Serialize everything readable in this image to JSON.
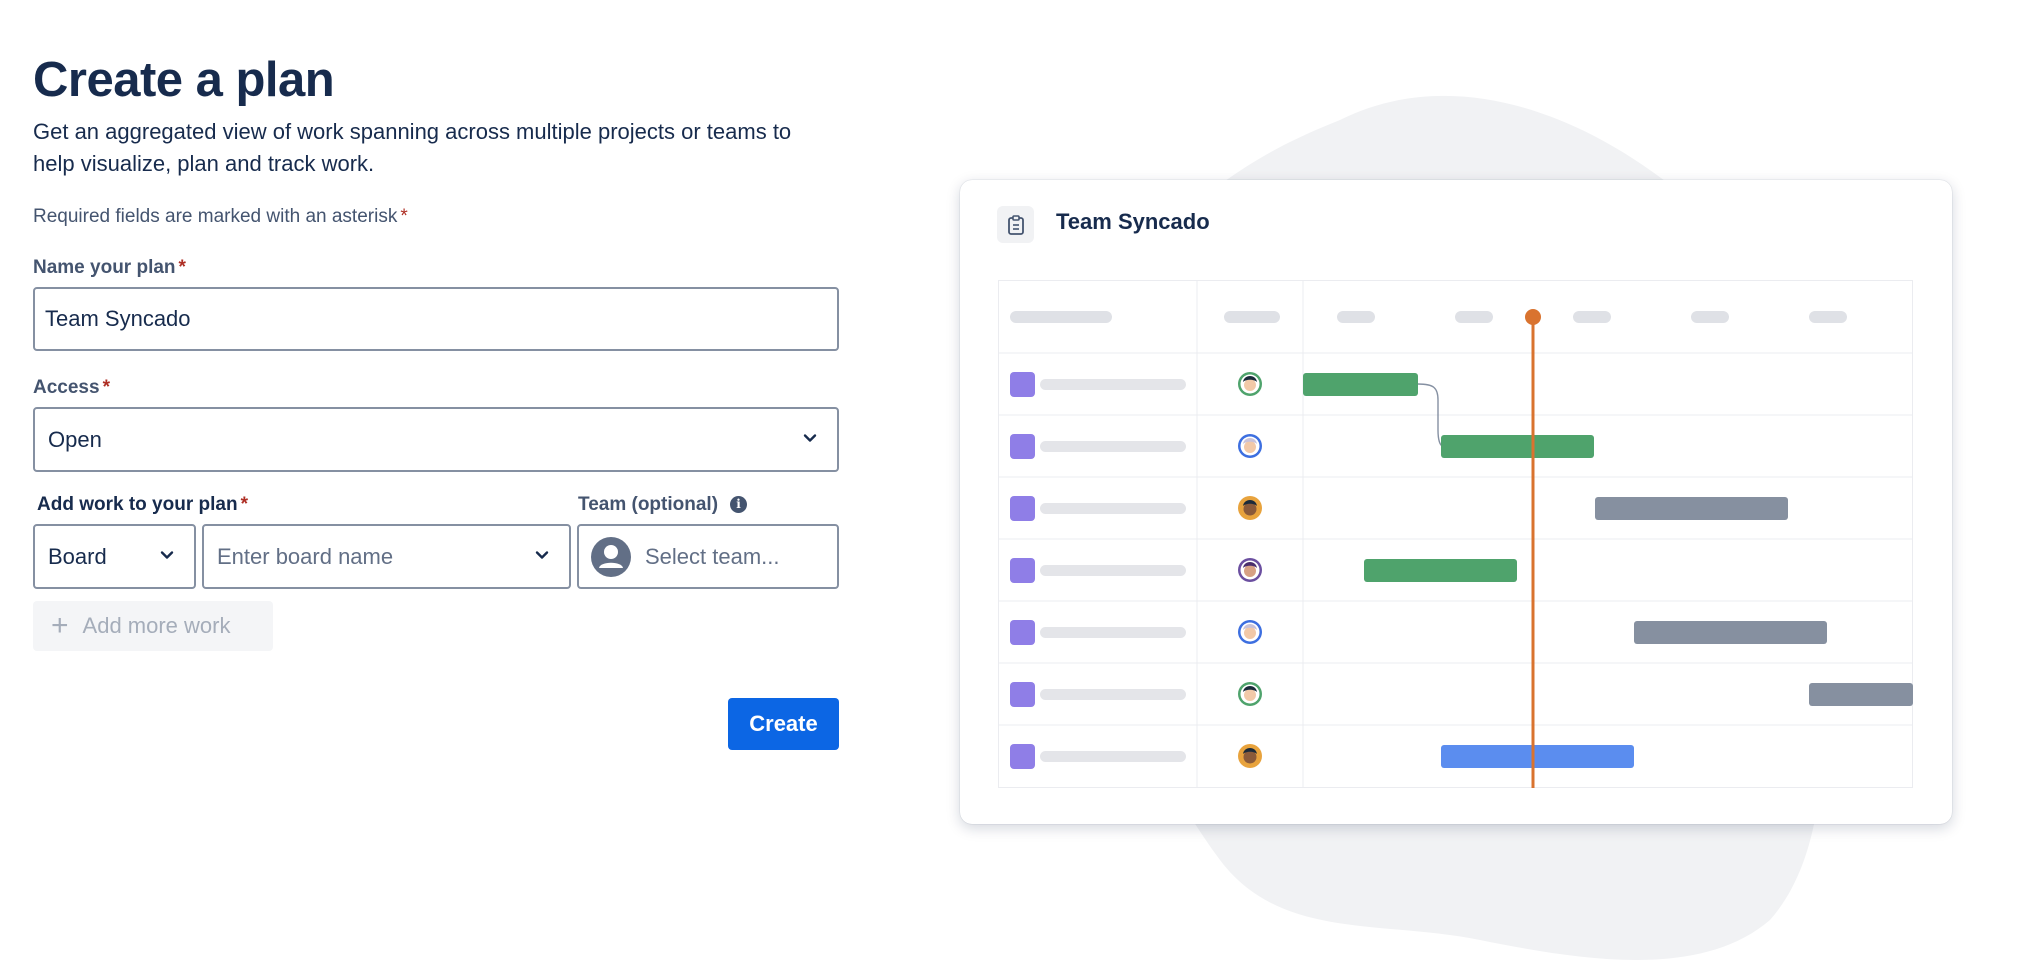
{
  "page": {
    "title": "Create a plan",
    "description": "Get an aggregated view of work spanning across multiple projects or teams to help visualize, plan and track work.",
    "required_note": "Required fields are marked with an asterisk",
    "asterisk": "*"
  },
  "form": {
    "name_label": "Name your plan",
    "name_value": "Team Syncado",
    "access_label": "Access",
    "access_value": "Open",
    "work_label": "Add work to your plan",
    "work_type_value": "Board",
    "board_placeholder": "Enter board name",
    "team_label": "Team (optional)",
    "team_placeholder": "Select team...",
    "add_more_label": "Add more work",
    "create_label": "Create"
  },
  "preview": {
    "title": "Team Syncado",
    "colors": {
      "green_bar": "#4fa36c",
      "gray_bar": "#8690a0",
      "blue_bar": "#5b8def",
      "today_line": "#d9732f",
      "row_square": "#8f7ee7"
    },
    "avatars": [
      "avatar-green",
      "avatar-blue",
      "avatar-orange",
      "avatar-purple",
      "avatar-blue",
      "avatar-green",
      "avatar-orange"
    ],
    "bar_colors": [
      "green",
      "green",
      "gray",
      "green",
      "gray",
      "gray",
      "blue"
    ]
  }
}
